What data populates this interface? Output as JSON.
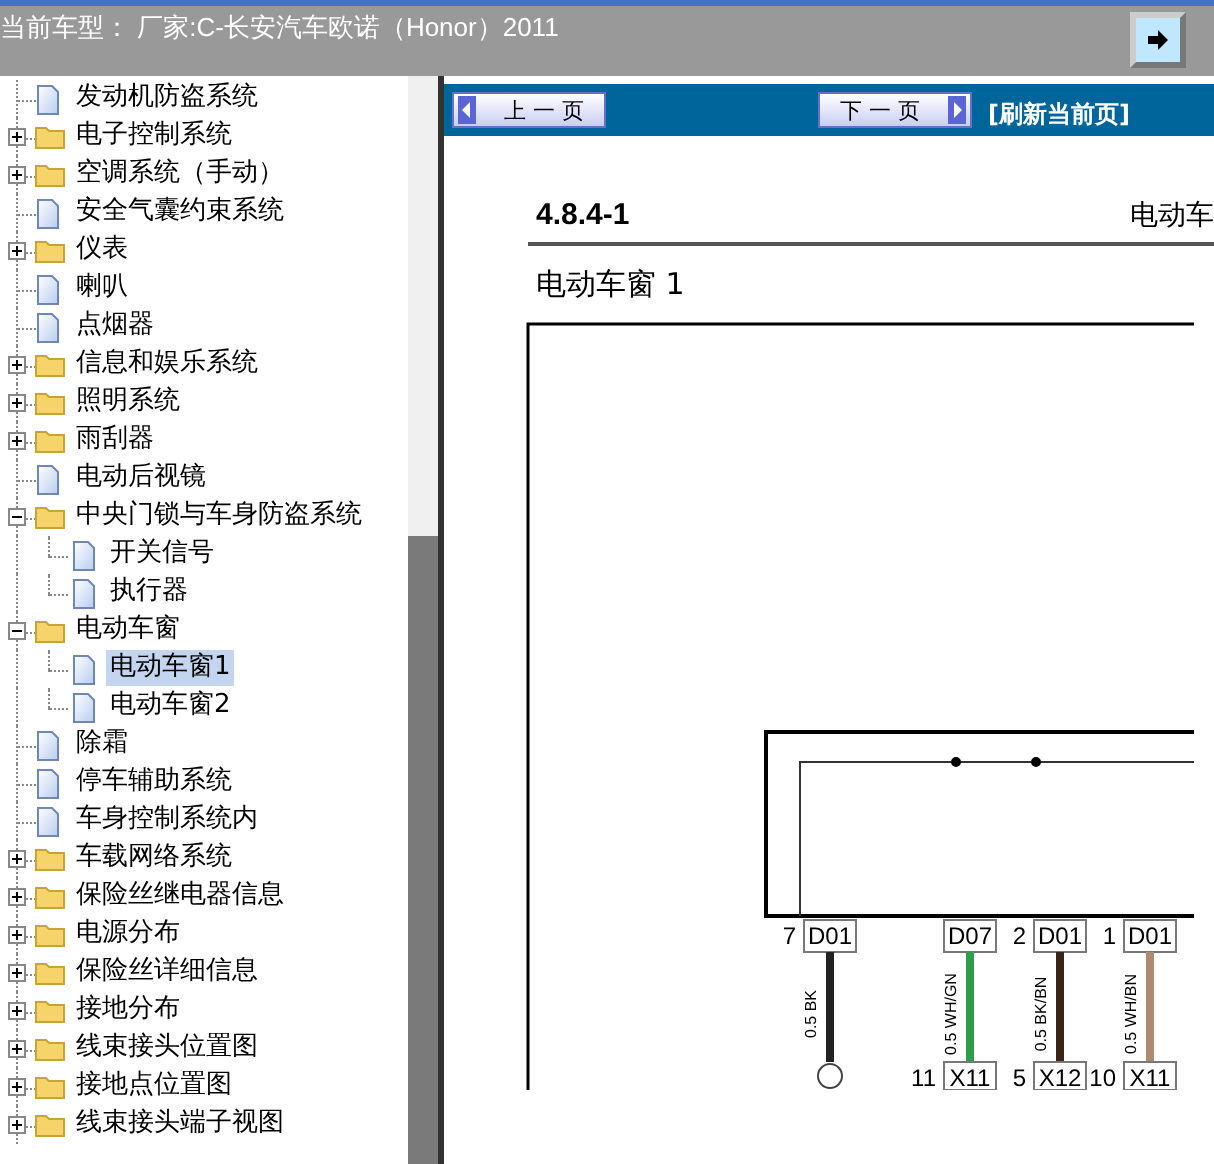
{
  "header": {
    "title": "当前车型：  厂家:C-长安汽车欧诺（Honor）2011"
  },
  "tree": {
    "items": [
      {
        "label": "发动机防盗系统",
        "kind": "page",
        "selected": false
      },
      {
        "label": "电子控制系统",
        "kind": "folder",
        "expanded": false,
        "selected": false
      },
      {
        "label": "空调系统（手动）",
        "kind": "folder",
        "expanded": false,
        "selected": false
      },
      {
        "label": "安全气囊约束系统",
        "kind": "page",
        "selected": false
      },
      {
        "label": "仪表",
        "kind": "folder",
        "expanded": false,
        "selected": false
      },
      {
        "label": "喇叭",
        "kind": "page",
        "selected": false
      },
      {
        "label": "点烟器",
        "kind": "page",
        "selected": false
      },
      {
        "label": "信息和娱乐系统",
        "kind": "folder",
        "expanded": false,
        "selected": false
      },
      {
        "label": "照明系统",
        "kind": "folder",
        "expanded": false,
        "selected": false
      },
      {
        "label": "雨刮器",
        "kind": "folder",
        "expanded": false,
        "selected": false
      },
      {
        "label": "电动后视镜",
        "kind": "page",
        "selected": false
      },
      {
        "label": "中央门锁与车身防盗系统",
        "kind": "folder",
        "expanded": true,
        "selected": false,
        "children": [
          {
            "label": "开关信号",
            "kind": "page",
            "selected": false
          },
          {
            "label": "执行器",
            "kind": "page",
            "selected": false
          }
        ]
      },
      {
        "label": "电动车窗",
        "kind": "folder",
        "expanded": true,
        "selected": false,
        "children": [
          {
            "label": "电动车窗1",
            "kind": "page",
            "selected": true
          },
          {
            "label": "电动车窗2",
            "kind": "page",
            "selected": false
          }
        ]
      },
      {
        "label": "除霜",
        "kind": "page",
        "selected": false
      },
      {
        "label": "停车辅助系统",
        "kind": "page",
        "selected": false
      },
      {
        "label": "车身控制系统内",
        "kind": "page",
        "selected": false
      },
      {
        "label": "车载网络系统",
        "kind": "folder",
        "expanded": false,
        "selected": false
      },
      {
        "label": "保险丝继电器信息",
        "kind": "folder",
        "expanded": false,
        "selected": false
      },
      {
        "label": "电源分布",
        "kind": "folder",
        "expanded": false,
        "selected": false
      },
      {
        "label": "保险丝详细信息",
        "kind": "folder",
        "expanded": false,
        "selected": false
      },
      {
        "label": "接地分布",
        "kind": "folder",
        "expanded": false,
        "selected": false
      },
      {
        "label": "线束接头位置图",
        "kind": "folder",
        "expanded": false,
        "selected": false
      },
      {
        "label": "接地点位置图",
        "kind": "folder",
        "expanded": false,
        "selected": false
      },
      {
        "label": "线束接头端子视图",
        "kind": "folder",
        "expanded": false,
        "selected": false
      }
    ]
  },
  "nav": {
    "prev": "上 一 页",
    "next": "下 一 页",
    "refresh": "[刷新当前页]"
  },
  "document": {
    "section": "4.8.4-1",
    "running_title": "电动车",
    "heading": "电动车窗 1",
    "pins": [
      {
        "number": "7",
        "connector": "D01",
        "wire": "0.5 BK",
        "color": "#222222"
      },
      {
        "connector": "D07",
        "wire": "0.5 WH/GN",
        "color": "#2e9e4a",
        "end_number": "11",
        "end_connector": "X11"
      },
      {
        "number": "2",
        "connector": "D01",
        "wire": "0.5 BK/BN",
        "color": "#3b2416",
        "end_number": "5",
        "end_connector": "X12"
      },
      {
        "number": "1",
        "connector": "D01",
        "wire": "0.5 WH/BN",
        "color": "#b08a6e",
        "end_number": "10",
        "end_connector": "X11"
      }
    ]
  }
}
